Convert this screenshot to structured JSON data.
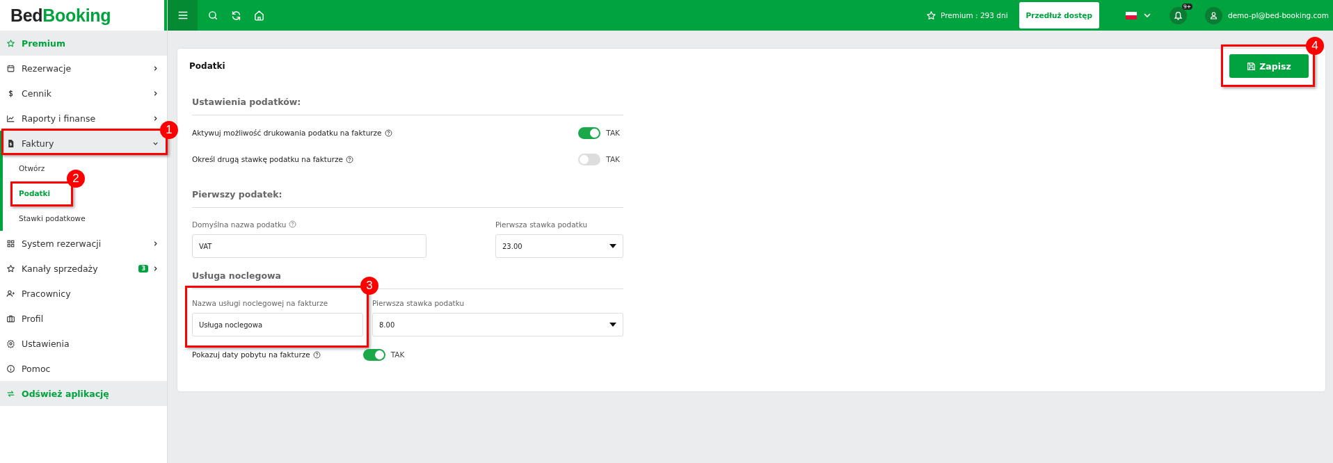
{
  "logo": {
    "first": "Bed",
    "second": "Booking"
  },
  "topbar": {
    "premium": "Premium : 293 dni",
    "extend_button": "Przedłuż dostęp",
    "notification_badge": "9+",
    "user_email": "demo-pl@bed-booking.com"
  },
  "sidebar": {
    "items": [
      {
        "label": "Premium",
        "kind": "accent"
      },
      {
        "label": "Rezerwacje",
        "kind": "link",
        "expanded": false
      },
      {
        "label": "Cennik",
        "kind": "link",
        "expanded": false
      },
      {
        "label": "Raporty i finanse",
        "kind": "link",
        "expanded": false
      },
      {
        "label": "Faktury",
        "kind": "link",
        "expanded": true,
        "callout": "1",
        "children": [
          {
            "label": "Otwórz",
            "selected": false
          },
          {
            "label": "Podatki",
            "selected": true,
            "callout": "2"
          },
          {
            "label": "Stawki podatkowe",
            "selected": false
          }
        ]
      },
      {
        "label": "System rezerwacji",
        "kind": "link",
        "expanded": false
      },
      {
        "label": "Kanały sprzedaży",
        "kind": "link",
        "expanded": false,
        "badge": "3"
      },
      {
        "label": "Pracownicy",
        "kind": "link"
      },
      {
        "label": "Profil",
        "kind": "link"
      },
      {
        "label": "Ustawienia",
        "kind": "link"
      },
      {
        "label": "Pomoc",
        "kind": "link"
      },
      {
        "label": "Odśwież aplikację",
        "kind": "accent"
      }
    ]
  },
  "page": {
    "title": "Podatki",
    "save_button": {
      "label": "Zapisz",
      "callout": "4"
    },
    "sections": [
      {
        "heading": "Ustawienia podatków:",
        "rows": [
          {
            "kind": "toggle",
            "label": "Aktywuj możliwość drukowania podatku na fakturze",
            "help": true,
            "on": true,
            "value_label": "TAK"
          },
          {
            "kind": "toggle",
            "label": "Określ drugą stawkę podatku na fakturze",
            "help": true,
            "on": false,
            "value_label": "TAK"
          }
        ]
      },
      {
        "heading": "Pierwszy podatek:",
        "rows": [
          {
            "kind": "fields",
            "fields": [
              {
                "kind": "text",
                "label": "Domyślna nazwa podatku",
                "help": true,
                "value": "VAT"
              },
              {
                "kind": "select",
                "label": "Pierwsza stawka podatku",
                "help": false,
                "value": "23.00"
              }
            ]
          }
        ]
      },
      {
        "heading": "Usługa noclegowa",
        "rows": [
          {
            "kind": "fields",
            "fields": [
              {
                "kind": "text",
                "label": "Nazwa usługi noclegowej na fakturze",
                "help": false,
                "value": "Usługa noclegowa",
                "callout": "3"
              },
              {
                "kind": "select",
                "label": "Pierwsza stawka podatku",
                "help": false,
                "value": "8.00"
              }
            ]
          },
          {
            "kind": "toggle",
            "label": "Pokazuj daty pobytu na fakturze",
            "help": true,
            "on": true,
            "value_label": "TAK"
          }
        ]
      }
    ]
  }
}
